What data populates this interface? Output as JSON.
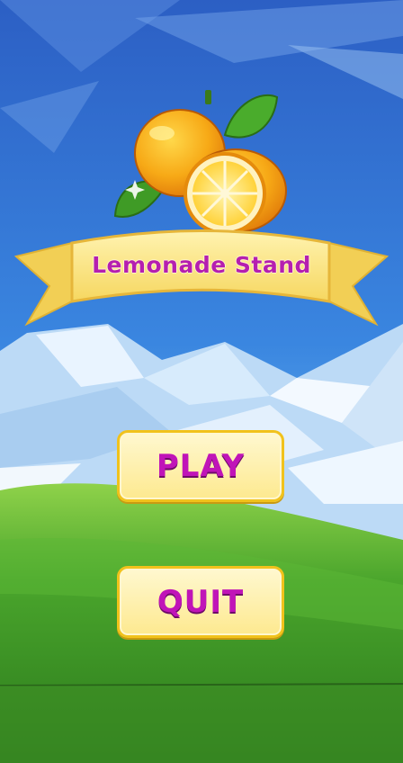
{
  "game": {
    "title": "Lemonade Stand"
  },
  "menu": {
    "play_label": "PLAY",
    "quit_label": "QUIT"
  },
  "colors": {
    "sky_top": "#2e63c8",
    "sky_bottom": "#5fb0f0",
    "grass": "#3f9a28",
    "button_fill": "#fdf0a8",
    "button_border": "#f1c21c",
    "label_magenta": "#c014b8",
    "ribbon": "#fbe58a"
  },
  "icons": [
    "lemon-logo-icon",
    "leaf-icon",
    "sparkle-icon"
  ]
}
